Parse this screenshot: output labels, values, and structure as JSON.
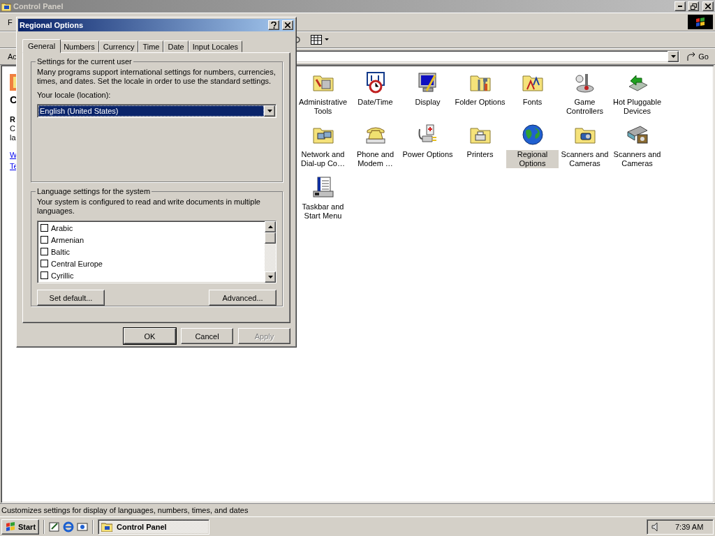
{
  "control_panel": {
    "title": "Control Panel",
    "menu_fragment": "F",
    "address_label": "Ac",
    "go_button": "Go",
    "left_pane": {
      "heading": "C",
      "lines": [
        "R",
        "C",
        "la"
      ],
      "links": [
        "W",
        "Te"
      ]
    },
    "items": [
      {
        "label": "Administrative Tools",
        "selected": false
      },
      {
        "label": "Date/Time",
        "selected": false
      },
      {
        "label": "Display",
        "selected": false
      },
      {
        "label": "Folder Options",
        "selected": false
      },
      {
        "label": "Fonts",
        "selected": false
      },
      {
        "label": "Game Controllers",
        "selected": false
      },
      {
        "label": "Hot Pluggable Devices",
        "selected": false
      },
      {
        "label": "Network and Dial-up Co…",
        "selected": false
      },
      {
        "label": "Phone and Modem …",
        "selected": false
      },
      {
        "label": "Power Options",
        "selected": false
      },
      {
        "label": "Printers",
        "selected": false
      },
      {
        "label": "Regional Options",
        "selected": true
      },
      {
        "label": "Scanners and Cameras",
        "selected": false
      },
      {
        "label": "Scanners and Cameras",
        "selected": false
      },
      {
        "label": "Taskbar and Start Menu",
        "selected": false
      }
    ],
    "status_bar": "Customizes settings for display of languages, numbers, times, and dates"
  },
  "dialog": {
    "title": "Regional Options",
    "tabs": [
      {
        "label": "General",
        "selected": true
      },
      {
        "label": "Numbers",
        "selected": false
      },
      {
        "label": "Currency",
        "selected": false
      },
      {
        "label": "Time",
        "selected": false
      },
      {
        "label": "Date",
        "selected": false
      },
      {
        "label": "Input Locales",
        "selected": false
      }
    ],
    "user_group": {
      "legend": "Settings for the current user",
      "description": "Many programs support international settings for numbers, currencies, times, and dates. Set the locale in order to use the standard settings.",
      "locale_label": "Your locale (location):",
      "locale_value": "English (United States)"
    },
    "system_group": {
      "legend": "Language settings for the system",
      "description": "Your system is configured to read and write documents in multiple languages.",
      "languages": [
        {
          "label": "Arabic",
          "checked": false
        },
        {
          "label": "Armenian",
          "checked": false
        },
        {
          "label": "Baltic",
          "checked": false
        },
        {
          "label": "Central Europe",
          "checked": false
        },
        {
          "label": "Cyrillic",
          "checked": false
        }
      ],
      "buttons": [
        "Set default...",
        "Advanced..."
      ]
    },
    "buttons": [
      {
        "label": "OK",
        "disabled": false
      },
      {
        "label": "Cancel",
        "disabled": false
      },
      {
        "label": "Apply",
        "disabled": true
      }
    ]
  },
  "taskbar": {
    "start": "Start",
    "tasks": [
      {
        "label": "Control Panel",
        "selected": true
      }
    ],
    "clock": "7:39 AM"
  }
}
